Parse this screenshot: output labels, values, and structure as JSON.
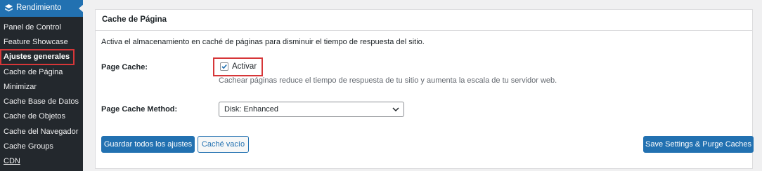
{
  "sidebar": {
    "header": "Rendimiento",
    "items": [
      {
        "label": "Panel de Control"
      },
      {
        "label": "Feature Showcase"
      },
      {
        "label": "Ajustes generales"
      },
      {
        "label": "Cache de Página"
      },
      {
        "label": "Minimizar"
      },
      {
        "label": "Cache Base de Datos"
      },
      {
        "label": "Cache de Objetos"
      },
      {
        "label": "Cache del Navegador"
      },
      {
        "label": "Cache Groups"
      },
      {
        "label": "CDN"
      }
    ]
  },
  "panel": {
    "title": "Cache de Página",
    "description": "Activa el almacenamiento en caché de páginas para disminuir el tiempo de respuesta del sitio.",
    "page_cache_label": "Page Cache:",
    "checkbox_label": "Activar",
    "checkbox_checked": true,
    "help_text": "Cachear páginas reduce el tiempo de respuesta de tu sitio y aumenta la escala de tu servidor web.",
    "method_label": "Page Cache Method:",
    "method_value": "Disk: Enhanced"
  },
  "buttons": {
    "save_all": "Guardar todos los ajustes",
    "empty_cache": "Caché vacío",
    "save_purge": "Save Settings & Purge Caches"
  },
  "colors": {
    "primary": "#2271b1",
    "highlight": "#d63638",
    "sidebar_bg": "#23282d"
  }
}
